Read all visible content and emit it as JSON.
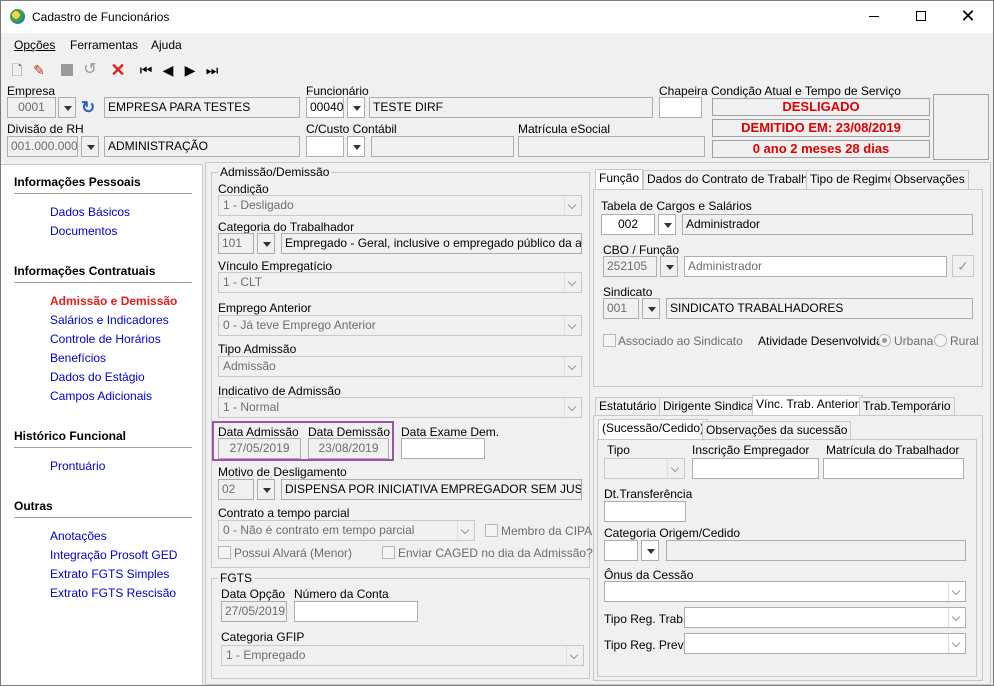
{
  "window": {
    "title": "Cadastro de Funcionários"
  },
  "menu": [
    "Opções",
    "Ferramentas",
    "Ajuda"
  ],
  "header": {
    "empresa_label": "Empresa",
    "empresa_code": "0001",
    "empresa_name": "EMPRESA PARA TESTES",
    "funcionario_label": "Funcionário",
    "funcionario_code": "00040",
    "funcionario_name": "TESTE DIRF",
    "chapeira_label": "Chapeira",
    "condicao_label": "Condição Atual e Tempo de Serviço",
    "status1": "DESLIGADO",
    "status2": "DEMITIDO EM: 23/08/2019",
    "status3": "0 ano 2 meses 28 dias",
    "divisao_label": "Divisão de RH",
    "divisao_code": "001.000.000",
    "divisao_name": "ADMINISTRAÇÃO",
    "ccusto_label": "C/Custo Contábil",
    "matricula_label": "Matrícula eSocial"
  },
  "nav": {
    "s1": "Informações Pessoais",
    "s1_items": [
      "Dados Básicos",
      "Documentos"
    ],
    "s2": "Informações Contratuais",
    "s2_active": "Admissão e Demissão",
    "s2_items": [
      "Salários e Indicadores",
      "Controle de Horários",
      "Benefícios",
      "Dados do Estágio",
      "Campos Adicionais"
    ],
    "s3": "Histórico Funcional",
    "s3_items": [
      "Prontuário"
    ],
    "s4": "Outras",
    "s4_items": [
      "Anotações",
      "Integração Prosoft GED",
      "Extrato FGTS Simples",
      "Extrato FGTS Rescisão"
    ]
  },
  "adm": {
    "group": "Admissão/Demissão",
    "condicao_label": "Condição",
    "condicao": "1 - Desligado",
    "categoria_label": "Categoria do Trabalhador",
    "categoria_code": "101",
    "categoria_desc": "Empregado - Geral, inclusive o empregado público da administ",
    "vinculo_label": "Vínculo Empregatício",
    "vinculo": "1 - CLT",
    "emprego_label": "Emprego Anterior",
    "emprego": "0 - Já teve Emprego Anterior",
    "tipo_label": "Tipo Admissão",
    "tipo": "Admissão",
    "indicativo_label": "Indicativo de Admissão",
    "indicativo": "1 - Normal",
    "data_adm_label": "Data Admissão",
    "data_adm": "27/05/2019",
    "data_dem_label": "Data Demissão",
    "data_dem": "23/08/2019",
    "data_exame_label": "Data Exame Dem.",
    "motivo_label": "Motivo de Desligamento",
    "motivo_code": "02",
    "motivo_desc": "DISPENSA POR INICIATIVA EMPREGADOR SEM JUSTA CAUSA",
    "contrato_label": "Contrato a tempo parcial",
    "contrato": "0 - Não é contrato em tempo parcial",
    "membro_cipa": "Membro da CIPA",
    "alvara": "Possui Alvará (Menor)",
    "caged": "Enviar CAGED no dia da Admissão?"
  },
  "fgts": {
    "group": "FGTS",
    "data_label": "Data Opção",
    "data": "27/05/2019",
    "conta_label": "Número da Conta",
    "cat_label": "Categoria GFIP",
    "cat": "1 - Empregado"
  },
  "tabs_top": [
    "Função",
    "Dados do Contrato de Trabalho",
    "Tipo de Regime",
    "Observações"
  ],
  "funcao": {
    "tabela_label": "Tabela de Cargos e Salários",
    "tabela_code": "002",
    "tabela_name": "Administrador",
    "cbo_label": "CBO / Função",
    "cbo_code": "252105",
    "cbo_name": "Administrador",
    "sindicato_label": "Sindicato",
    "sind_code": "001",
    "sind_name": "SINDICATO TRABALHADORES",
    "associado": "Associado ao Sindicato",
    "atividade_label": "Atividade Desenvolvida:",
    "urbana": "Urbana",
    "rural": "Rural"
  },
  "tabs_bottom": [
    "Estatutário",
    "Dirigente Sindical",
    "Vínc. Trab. Anterior",
    "Trab.Temporário"
  ],
  "subtabs": [
    "(Sucessão/Cedido)",
    "Observações da sucessão"
  ],
  "vinc": {
    "tipo_label": "Tipo",
    "inscricao_label": "Inscrição Empregador",
    "matricula_label": "Matrícula do Trabalhador",
    "dt_label": "Dt.Transferência",
    "categoria_label": "Categoria Origem/Cedido",
    "onus_label": "Ônus da Cessão",
    "reg_trab_label": "Tipo Reg. Trab.",
    "reg_prev_label": "Tipo Reg. Prev."
  }
}
